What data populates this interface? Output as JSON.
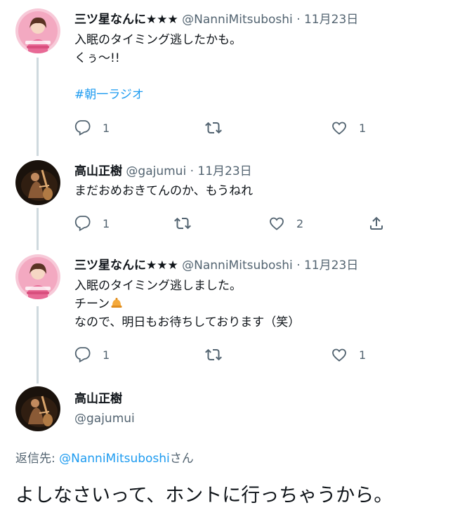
{
  "tweets": [
    {
      "name": "三ツ星なんに★★★",
      "handle": "@NanniMitsuboshi",
      "date": "· 11月23日",
      "line1": "入眠のタイミング逃したかも。",
      "line2": "くぅ〜!!",
      "hashtag": "#朝一ラジオ",
      "reply_count": "1",
      "retweet_count": "",
      "like_count": "1"
    },
    {
      "name": "高山正樹",
      "handle": "@gajumui",
      "date": "· 11月23日",
      "line1": "まだおめおきてんのか、もうねれ",
      "reply_count": "1",
      "retweet_count": "",
      "like_count": "2"
    },
    {
      "name": "三ツ星なんに★★★",
      "handle": "@NanniMitsuboshi",
      "date": "· 11月23日",
      "line1": "入眠のタイミング逃しました。",
      "line2": "チーン",
      "line3": "なので、明日もお待ちしております（笑）",
      "reply_count": "1",
      "retweet_count": "",
      "like_count": "1"
    }
  ],
  "main_tweet": {
    "name": "高山正樹",
    "handle": "@gajumui",
    "reply_prefix": "返信先:",
    "reply_mention": "@NanniMitsuboshi",
    "reply_suffix": "さん",
    "text": "よしなさいって、ホントに行っちゃうから。"
  },
  "icons": {
    "reply": "reply-icon",
    "retweet": "retweet-icon",
    "like": "heart-icon",
    "share": "share-icon",
    "bell": "bell-emoji"
  },
  "colors": {
    "accent": "#1d9bf0",
    "muted": "#536471",
    "text": "#0f1419",
    "thread_line": "#cfd9de"
  }
}
